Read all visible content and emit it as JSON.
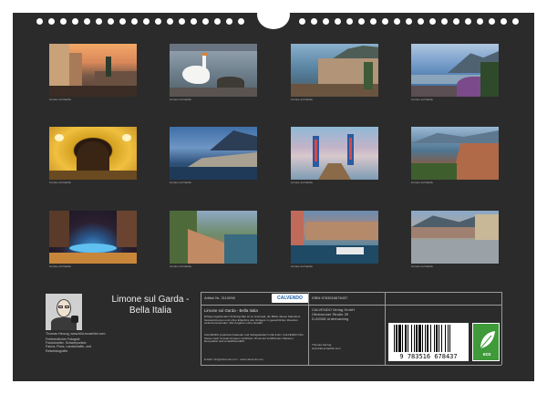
{
  "calendar": {
    "title": "Limone sul Garda -\nBella Italia",
    "article_label": "Artikel Nr. 2110098",
    "publisher_logo": "CALVENDO",
    "isbn": "ISBN 9783516678437",
    "panel_title": "Limone sul Garda - Bella Italia",
    "panel_description": "Erfolge begleitenden Schutzgeräte ist es untersagt, die Bilder dieses Kalenders herauszutrennen und ohne Erlaubnis des Verlages zu gewerblichen Zwecken weiterzuverwenden. Wie Angaben ohne Gewähr.",
    "panel_legal": "CALVENDO produziert Kalender und Verlagsbedarf in DE & EU. CALVENDO ISO-Kisses nach Umwelt-Gruppen zertifiziert. Druck auf zertifizierten Papieren. Recycelbar und umweltfreundlich.",
    "email": "E-Mail: info@calvendo.com · www.calvendo.com",
    "publisher_name": "CALVENDO Verlag GmbH",
    "publisher_street": "Ottobrunner Straße 39",
    "publisher_city": "D-82008 Unterhaching",
    "photographer_name": "Thomas Herzog",
    "photographer_site": "www.bild-erzaehler.com",
    "author_name_url": "Thomas Herzog, www.bild-erzaehler.com",
    "author_bio": "Freiberuflicher Fotograf. Fotokünstler. Schwerpunkte: Fauna, Flora, Landschafts- und Reisefotografie.",
    "barcode_digits": "9 783516 678437",
    "eco_label": "eco"
  },
  "months": [
    {
      "caption": "Limone sul Garda"
    },
    {
      "caption": "Limone sul Garda"
    },
    {
      "caption": "Limone sul Garda"
    },
    {
      "caption": "Limone sul Garda"
    },
    {
      "caption": "Limone sul Garda"
    },
    {
      "caption": "Limone sul Garda"
    },
    {
      "caption": "Limone sul Garda"
    },
    {
      "caption": "Limone sul Garda"
    },
    {
      "caption": "Limone sul Garda"
    },
    {
      "caption": "Limone sul Garda"
    },
    {
      "caption": "Limone sul Garda"
    },
    {
      "caption": "Limone sul Garda"
    }
  ]
}
